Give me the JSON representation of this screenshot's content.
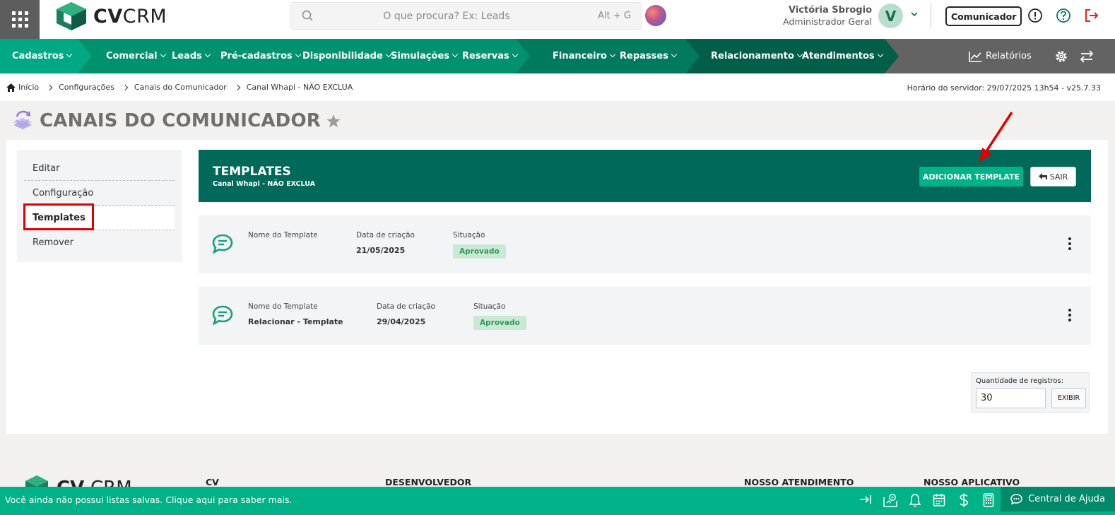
{
  "app": {
    "logo_text_bold": "CV",
    "logo_text_light": "CRM"
  },
  "search": {
    "placeholder": "O que procura? Ex: Leads",
    "shortcut": "Alt + G"
  },
  "user": {
    "name": "Victória Sbrogio",
    "role": "Administrador Geral",
    "initial": "V"
  },
  "header": {
    "comunicador_label": "Comunicador"
  },
  "nav": {
    "items": [
      {
        "label": "Cadastros"
      },
      {
        "label": "Comercial"
      },
      {
        "label": "Leads"
      },
      {
        "label": "Pré-cadastros"
      },
      {
        "label": "Disponibilidade"
      },
      {
        "label": "Simulações"
      },
      {
        "label": "Reservas"
      },
      {
        "label": "Financeiro"
      },
      {
        "label": "Repasses"
      },
      {
        "label": "Relacionamento"
      },
      {
        "label": "Atendimentos"
      }
    ],
    "reports_label": "Relatórios"
  },
  "breadcrumb": [
    "Início",
    "Configurações",
    "Canais do Comunicador",
    "Canal Whapi - NÃO EXCLUA"
  ],
  "server_info": "Horário do servidor: 29/07/2025 13h54 - v25.7.33",
  "page": {
    "title": "CANAIS DO COMUNICADOR"
  },
  "side_menu": [
    {
      "label": "Editar"
    },
    {
      "label": "Configuração"
    },
    {
      "label": "Templates"
    },
    {
      "label": "Remover"
    }
  ],
  "templates_header": {
    "title": "TEMPLATES",
    "subtitle": "Canal Whapi - NÃO EXCLUA",
    "add_label": "ADICIONAR TEMPLATE",
    "exit_label": "SAIR"
  },
  "templates": [
    {
      "name_label": "Nome do Template",
      "name": "",
      "date_label": "Data de criação",
      "date": "21/05/2025",
      "status_label": "Situação",
      "status": "Aprovado"
    },
    {
      "name_label": "Nome do Template",
      "name": "Relacionar - Template",
      "date_label": "Data de criação",
      "date": "29/04/2025",
      "status_label": "Situação",
      "status": "Aprovado"
    }
  ],
  "records": {
    "label": "Quantidade de registros:",
    "value": "30",
    "button": "EXIBIR"
  },
  "footer": {
    "columns": [
      "CV",
      "DESENVOLVEDOR",
      "NOSSO ATENDIMENTO",
      "NOSSO APLICATIVO"
    ],
    "message": "Você ainda não possui listas salvas. Clique aqui para saber mais.",
    "help_label": "Central de Ajuda"
  },
  "colors": {
    "brand": "#00b287",
    "header_dark": "#00695a",
    "annotation": "#e30000"
  }
}
